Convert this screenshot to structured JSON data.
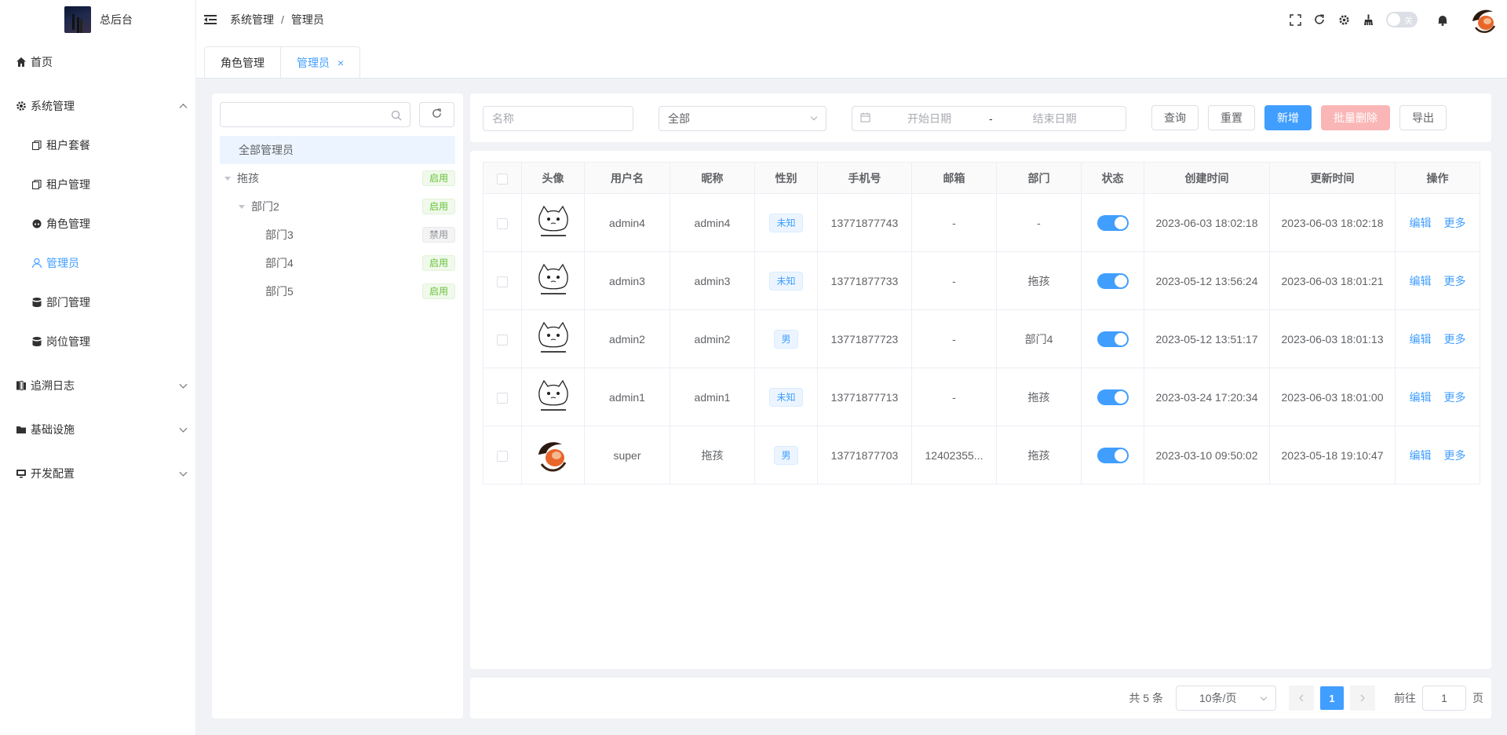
{
  "app": {
    "title": "总后台"
  },
  "sidebar": {
    "items": [
      {
        "label": "首页",
        "icon": "home-icon"
      },
      {
        "label": "系统管理",
        "icon": "gear-icon",
        "expanded": true
      },
      {
        "label": "租户套餐",
        "icon": "copy-icon"
      },
      {
        "label": "租户管理",
        "icon": "copy-icon"
      },
      {
        "label": "角色管理",
        "icon": "role-icon"
      },
      {
        "label": "管理员",
        "icon": "user-icon",
        "active": true
      },
      {
        "label": "部门管理",
        "icon": "database-icon"
      },
      {
        "label": "岗位管理",
        "icon": "database-icon"
      },
      {
        "label": "追溯日志",
        "icon": "log-icon"
      },
      {
        "label": "基础设施",
        "icon": "folder-icon"
      },
      {
        "label": "开发配置",
        "icon": "monitor-icon"
      }
    ]
  },
  "header": {
    "breadcrumb": [
      "系统管理",
      "管理员"
    ],
    "breadcrumb_sep": "/",
    "theme_toggle_label": "关"
  },
  "tabs": [
    {
      "label": "角色管理"
    },
    {
      "label": "管理员",
      "active": true,
      "close": "×"
    }
  ],
  "tree": {
    "search_placeholder": "",
    "nodes": [
      {
        "label": "全部管理员",
        "tag": ""
      },
      {
        "label": "拖孩",
        "tag": "启用"
      },
      {
        "label": "部门2",
        "tag": "启用"
      },
      {
        "label": "部门3",
        "tag": "禁用"
      },
      {
        "label": "部门4",
        "tag": "启用"
      },
      {
        "label": "部门5",
        "tag": "启用"
      }
    ]
  },
  "search": {
    "name_placeholder": "名称",
    "status_value": "全部",
    "start_date_placeholder": "开始日期",
    "date_sep": "-",
    "end_date_placeholder": "结束日期",
    "query_label": "查询",
    "reset_label": "重置",
    "add_label": "新增",
    "batch_delete_label": "批量删除",
    "export_label": "导出"
  },
  "table": {
    "headers": [
      "头像",
      "用户名",
      "昵称",
      "性别",
      "手机号",
      "邮箱",
      "部门",
      "状态",
      "创建时间",
      "更新时间",
      "操作"
    ],
    "edit_label": "编辑",
    "more_label": "更多",
    "rows": [
      {
        "username": "admin4",
        "nickname": "admin4",
        "gender": "未知",
        "phone": "13771877743",
        "email": "-",
        "dept": "-",
        "status": true,
        "created": "2023-06-03 18:02:18",
        "updated": "2023-06-03 18:02:18",
        "avatar": "cat-meme"
      },
      {
        "username": "admin3",
        "nickname": "admin3",
        "gender": "未知",
        "phone": "13771877733",
        "email": "-",
        "dept": "拖孩",
        "status": true,
        "created": "2023-05-12 13:56:24",
        "updated": "2023-06-03 18:01:21",
        "avatar": "cat-meme"
      },
      {
        "username": "admin2",
        "nickname": "admin2",
        "gender": "男",
        "phone": "13771877723",
        "email": "-",
        "dept": "部门4",
        "status": true,
        "created": "2023-05-12 13:51:17",
        "updated": "2023-06-03 18:01:13",
        "avatar": "cat-meme"
      },
      {
        "username": "admin1",
        "nickname": "admin1",
        "gender": "未知",
        "phone": "13771877713",
        "email": "-",
        "dept": "拖孩",
        "status": true,
        "created": "2023-03-24 17:20:34",
        "updated": "2023-06-03 18:01:00",
        "avatar": "cat-meme"
      },
      {
        "username": "super",
        "nickname": "拖孩",
        "gender": "男",
        "phone": "13771877703",
        "email": "12402355...",
        "dept": "拖孩",
        "status": true,
        "created": "2023-03-10 09:50:02",
        "updated": "2023-05-18 19:10:47",
        "avatar": "bird-logo"
      }
    ]
  },
  "pagination": {
    "total_label": "共 5 条",
    "page_size": "10条/页",
    "current_page": "1",
    "goto_label": "前往",
    "goto_value": "1",
    "page_suffix": "页"
  },
  "colors": {
    "primary": "#409eff",
    "success": "#67c23a",
    "danger_light": "#fab6b6"
  }
}
